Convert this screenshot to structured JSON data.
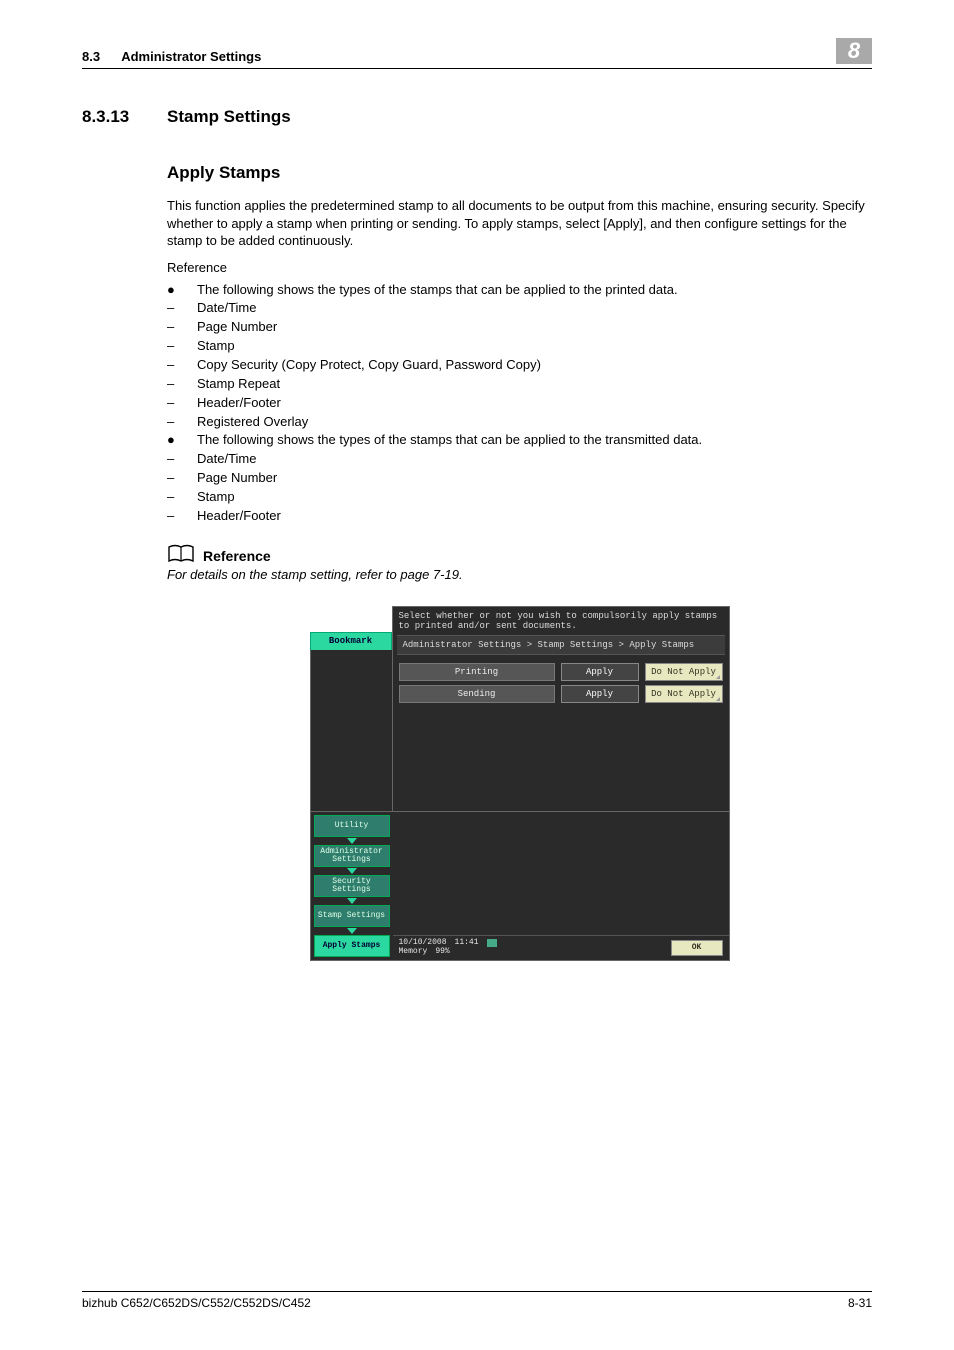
{
  "header": {
    "section_number": "8.3",
    "section_title": "Administrator Settings",
    "chapter": "8"
  },
  "heading": {
    "number": "8.3.13",
    "title": "Stamp Settings"
  },
  "subsection": {
    "title": "Apply Stamps"
  },
  "body": {
    "para1": "This function applies the predetermined stamp to all documents to be output from this machine, ensuring security. Specify whether to apply a stamp when printing or sending. To apply stamps, select [Apply], and then configure settings for the stamp to be added continuously.",
    "reference_word": "Reference",
    "bullet_intro_print": "The following shows the types of the stamps that can be applied to the printed data.",
    "print_items": [
      "Date/Time",
      "Page Number",
      "Stamp",
      "Copy Security (Copy Protect, Copy Guard, Password Copy)",
      "Stamp Repeat",
      "Header/Footer",
      "Registered Overlay"
    ],
    "bullet_intro_tx": "The following shows the types of the stamps that can be applied to the transmitted data.",
    "tx_items": [
      "Date/Time",
      "Page Number",
      "Stamp",
      "Header/Footer"
    ]
  },
  "reference_block": {
    "title": "Reference",
    "text": "For details on the stamp setting, refer to page 7-19."
  },
  "device": {
    "instruction": "Select whether or not you wish to compulsorily apply stamps to printed and/or sent documents.",
    "bookmark": "Bookmark",
    "breadcrumb": "Administrator Settings > Stamp Settings > Apply Stamps",
    "rows": [
      {
        "label": "Printing",
        "apply": "Apply",
        "not_apply": "Do Not Apply"
      },
      {
        "label": "Sending",
        "apply": "Apply",
        "not_apply": "Do Not Apply"
      }
    ],
    "nav": [
      "Utility",
      "Administrator Settings",
      "Security Settings",
      "Stamp Settings",
      "Apply Stamps"
    ],
    "status": {
      "date": "10/10/2008",
      "time": "11:41",
      "memory_label": "Memory",
      "memory_value": "99%",
      "ok": "OK"
    }
  },
  "footer": {
    "left": "bizhub C652/C652DS/C552/C552DS/C452",
    "right": "8-31"
  }
}
